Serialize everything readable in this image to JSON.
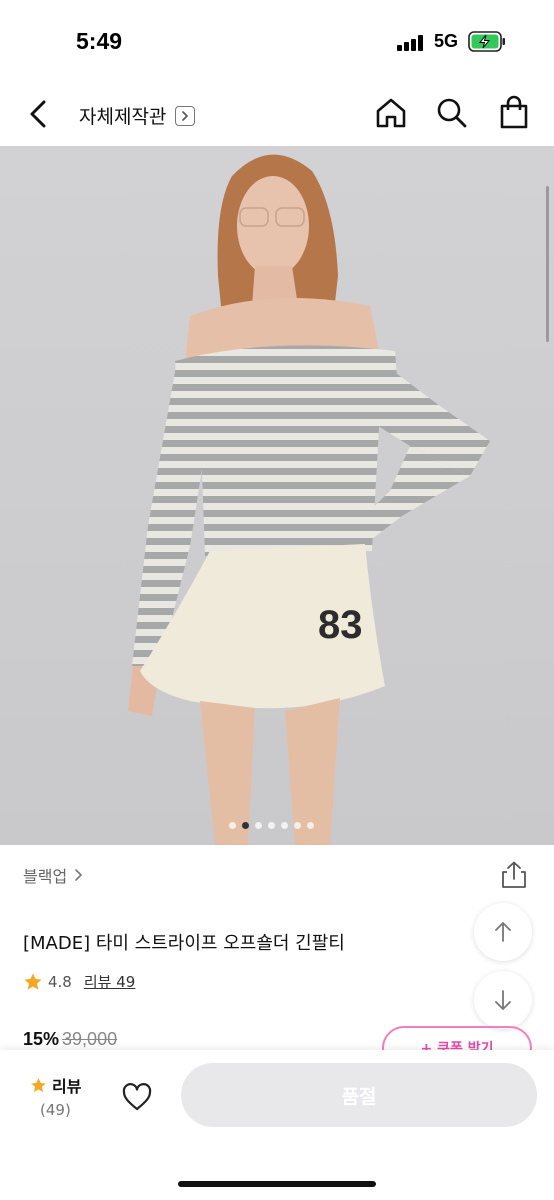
{
  "status_bar": {
    "time": "5:49",
    "network": "5G",
    "battery_state": "charging"
  },
  "nav": {
    "back_icon": "chevron-left-icon",
    "title": "자체제작관",
    "title_icon": "chevron-right-icon",
    "icons": [
      "home-icon",
      "search-icon",
      "shopping-bag-icon"
    ]
  },
  "product": {
    "image_description_icon": "product-photo",
    "carousel": {
      "total": 7,
      "active_index": 1
    },
    "category": "블랙업",
    "title": "[MADE] 타미 스트라이프 오프숄더 긴팔티",
    "rating": "4.8",
    "review_label": "리뷰 49",
    "discount": "15%",
    "original_price": "39,000",
    "coupon_label": "+ 쿠폰 받기"
  },
  "bottom_bar": {
    "review_label": "리뷰",
    "review_count": "(49)",
    "buy_label": "품절"
  },
  "colors": {
    "accent_pink": "#e84ba6",
    "star": "#f5a623",
    "disabled_button": "#e8e8ea"
  }
}
